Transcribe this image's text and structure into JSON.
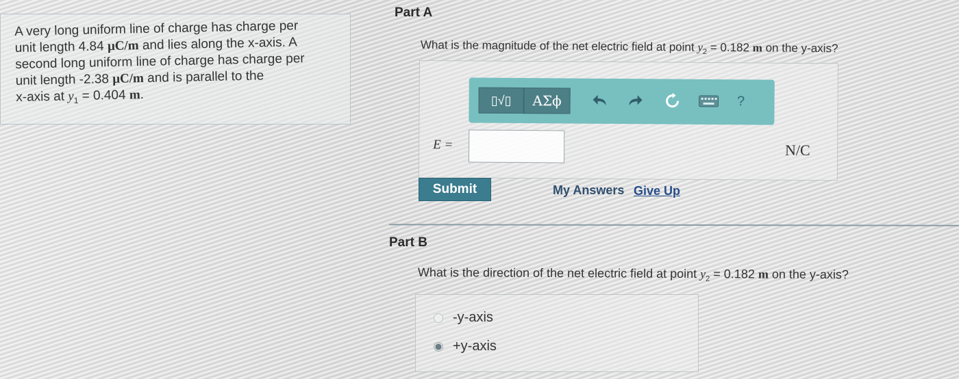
{
  "problem": {
    "line1": "A very long uniform line of charge has charge per",
    "line2_pre": "unit length 4.84",
    "line2_unit": "μC/m",
    "line2_post": "and lies along the x-axis. A",
    "line3": "second long uniform line of charge has charge per",
    "line4_pre": "unit length -2.38",
    "line4_unit": "μC/m",
    "line4_post": "and is parallel to the",
    "line5_pre": "x-axis at",
    "line5_var": "y",
    "line5_sub": "1",
    "line5_eq": "= 0.404",
    "line5_unit": "m",
    "line5_end": "."
  },
  "part_a": {
    "heading": "Part A",
    "question_pre": "What is the magnitude of the net electric field at point",
    "question_var": "y",
    "question_sub": "2",
    "question_eq": "= 0.182",
    "question_unit": "m",
    "question_post": "on the y-axis?",
    "toolbar": {
      "template_glyph": "▯√▯",
      "greek_glyph": "ΑΣϕ",
      "help_glyph": "?",
      "undo_icon": "undo-arrow",
      "redo_icon": "redo-arrow",
      "reset_icon": "refresh",
      "keyboard_icon": "keyboard"
    },
    "answer_label": "E =",
    "answer_value": "",
    "unit": "N/C",
    "submit_label": "Submit",
    "my_answers_label": "My Answers",
    "give_up_label": "Give Up"
  },
  "part_b": {
    "heading": "Part B",
    "question_pre": "What is the direction of the net electric field at point",
    "question_var": "y",
    "question_sub": "2",
    "question_eq": "= 0.182",
    "question_unit": "m",
    "question_post": "on the y-axis?",
    "choices": [
      {
        "label": "-y-axis",
        "selected": false
      },
      {
        "label": "+y-axis",
        "selected": true
      }
    ]
  },
  "colors": {
    "toolbar_bg": "#78bfc0",
    "toolbar_button": "#4d7f86",
    "submit_bg": "#3b7c8f",
    "link": "#274d89"
  }
}
